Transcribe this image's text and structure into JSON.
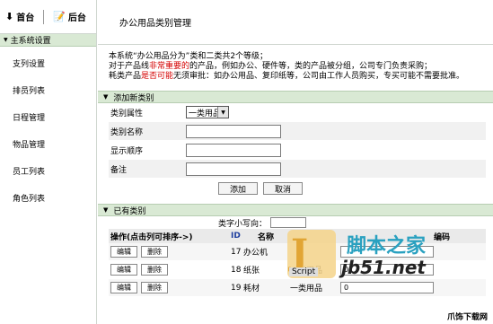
{
  "topnav": {
    "home": "首台",
    "back": "后台"
  },
  "sidebar": {
    "section": "主系统设置",
    "items": [
      {
        "label": "支列设置"
      },
      {
        "label": "排员列表"
      },
      {
        "label": "日程管理"
      },
      {
        "label": "物品管理"
      },
      {
        "label": "员工列表"
      },
      {
        "label": "角色列表"
      }
    ]
  },
  "main": {
    "title": "办公用品类别管理",
    "notes": {
      "line1": "本系统“办公用品分为”类和二类共2个等级；",
      "line2_pre": "对于产品线",
      "line2_hl": "非常重要的",
      "line2_post": "的产品，例如办公、硬件等，类的产品被分组，公司专门负责采购；",
      "line3_pre": "耗类产品",
      "line3_hl": "是否可能",
      "line3_post": "无须审批：如办公用品、复印纸等，公司由工作人员购买，专买可能不需要批准。"
    },
    "add_section": {
      "title": "添加新类别",
      "fields": {
        "category_label": "类别属性",
        "category_value": "一类用品",
        "name_label": "类别名称",
        "order_label": "显示顺序",
        "note_label": "备注"
      },
      "submit": "添加",
      "cancel": "取消"
    },
    "list_section": {
      "title": "已有类别",
      "sort_label": "类字小写向：",
      "sort_value": "",
      "headers": {
        "ops": "操作(点击列可排序->)",
        "id": "ID",
        "name": "名称",
        "attr": "类别",
        "code": "编码"
      },
      "edit": "编辑",
      "delete": "删除",
      "rows": [
        {
          "id": "17",
          "name": "办公机",
          "attr": "",
          "value": ""
        },
        {
          "id": "18",
          "name": "纸张",
          "attr": "一类用品",
          "value": "0"
        },
        {
          "id": "19",
          "name": "耗材",
          "attr": "一类用品",
          "value": "0"
        }
      ]
    }
  },
  "watermark": {
    "script": "Script",
    "cn": "脚本之家",
    "url": "jb51.net",
    "corner": "爪饰下载网"
  }
}
